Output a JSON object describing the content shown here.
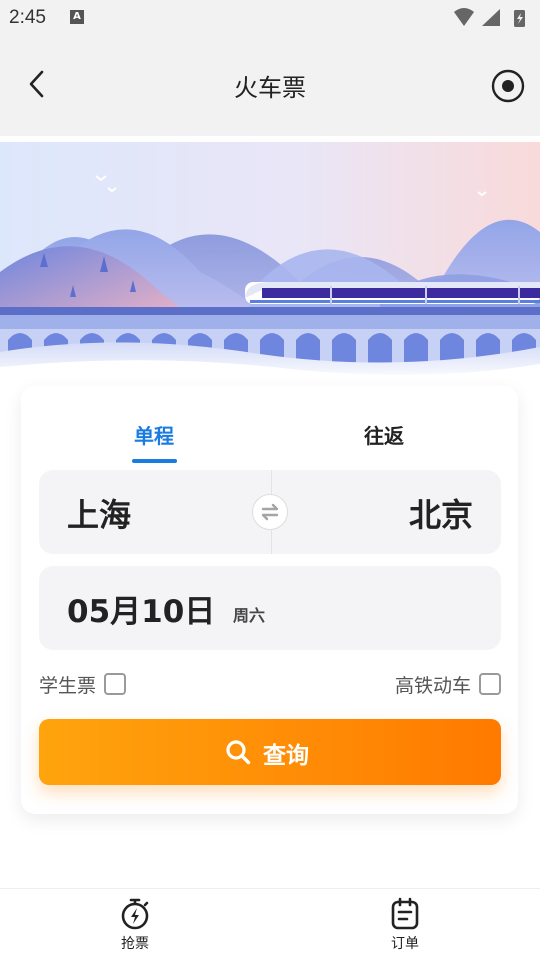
{
  "status_bar": {
    "time": "2:45",
    "notification_icon": "A"
  },
  "header": {
    "title": "火车票",
    "back_icon": "chevron-left-icon",
    "right_icon": "record-icon"
  },
  "trip_tabs": [
    {
      "label": "单程",
      "selected": true
    },
    {
      "label": "往返",
      "selected": false
    }
  ],
  "route": {
    "from": "上海",
    "to": "北京",
    "swap_icon": "swap-icon"
  },
  "date": {
    "value": "05月10日",
    "weekday": "周六"
  },
  "options": {
    "student_label": "学生票",
    "student_checked": false,
    "highspeed_label": "高铁动车",
    "highspeed_checked": false
  },
  "search_button": {
    "label": "查询",
    "icon": "search-icon"
  },
  "bottom_nav": [
    {
      "label": "抢票",
      "icon": "stopwatch-icon"
    },
    {
      "label": "订单",
      "icon": "clipboard-icon"
    }
  ],
  "colors": {
    "accent_blue": "#1a7be0",
    "search_orange_start": "#ffa40d",
    "search_orange_end": "#ff7a00"
  }
}
